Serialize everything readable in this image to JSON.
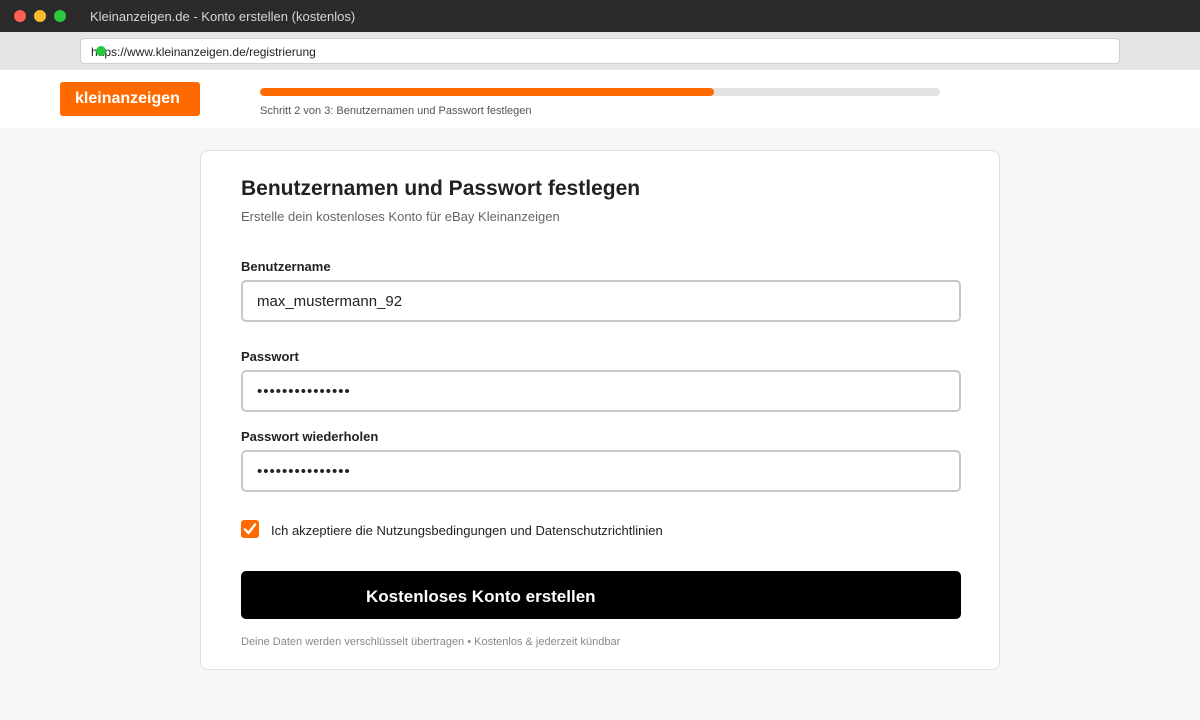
{
  "window": {
    "title": "Kleinanzeigen.de - Konto erstellen (kostenlos)"
  },
  "browser": {
    "url": "https://www.kleinanzeigen.de/registrierung"
  },
  "header": {
    "logo_text": "kleinanzeigen",
    "progress": {
      "fraction": 0.667,
      "label": "Schritt 2 von 3: Benutzernamen und Passwort festlegen"
    }
  },
  "form": {
    "title": "Benutzernamen und Passwort festlegen",
    "subtitle": "Erstelle dein kostenloses Konto für eBay Kleinanzeigen",
    "username": {
      "label": "Benutzername",
      "value": "max_mustermann_92"
    },
    "password": {
      "label": "Passwort",
      "value": "•••••••••••••••"
    },
    "password_repeat": {
      "label": "Passwort wiederholen",
      "value": "•••••••••••••••"
    },
    "terms": {
      "label": "Ich akzeptiere die Nutzungsbedingungen und Datenschutzrichtlinien",
      "checked": true
    },
    "submit_label": "Kostenloses Konto erstellen",
    "footnote": "Deine Daten werden verschlüsselt übertragen • Kostenlos & jederzeit kündbar"
  },
  "colors": {
    "brand": "#ff6a00",
    "button": "#000000"
  },
  "icons": {
    "secure": "secure-status-icon",
    "checkbox": "checkmark-icon"
  }
}
